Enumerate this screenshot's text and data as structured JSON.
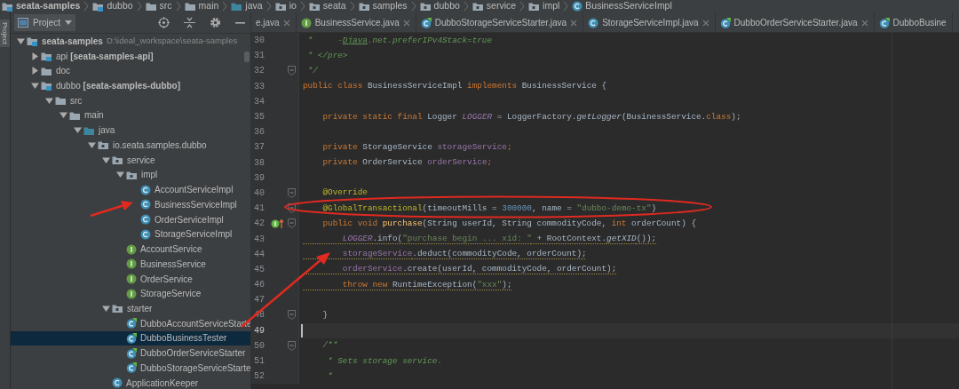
{
  "breadcrumbs": [
    {
      "label": "seata-samples",
      "kind": "module"
    },
    {
      "label": "dubbo",
      "kind": "module"
    },
    {
      "label": "src",
      "kind": "folder"
    },
    {
      "label": "main",
      "kind": "folder"
    },
    {
      "label": "java",
      "kind": "source"
    },
    {
      "label": "io",
      "kind": "package"
    },
    {
      "label": "seata",
      "kind": "package"
    },
    {
      "label": "samples",
      "kind": "package"
    },
    {
      "label": "dubbo",
      "kind": "package"
    },
    {
      "label": "service",
      "kind": "package"
    },
    {
      "label": "impl",
      "kind": "package"
    },
    {
      "label": "BusinessServiceImpl",
      "kind": "class"
    }
  ],
  "side_strip": {
    "label": "Project"
  },
  "project_panel": {
    "title": "Project",
    "tree": [
      {
        "label": "seata-samples",
        "path": "D:\\ideal_workspace\\seata-samples",
        "kind": "module",
        "expanded": true,
        "selected": false,
        "children": [
          {
            "label": "api **[seata-samples-api]**",
            "kind": "module",
            "expanded": false,
            "selected": false
          },
          {
            "label": "doc",
            "kind": "folder",
            "expanded": false,
            "selected": false
          },
          {
            "label": "dubbo **[seata-samples-dubbo]**",
            "kind": "module",
            "expanded": true,
            "selected": false,
            "children": [
              {
                "label": "src",
                "kind": "folder",
                "expanded": true,
                "selected": false,
                "children": [
                  {
                    "label": "main",
                    "kind": "folder",
                    "expanded": true,
                    "selected": false,
                    "children": [
                      {
                        "label": "java",
                        "kind": "source",
                        "expanded": true,
                        "selected": false,
                        "children": [
                          {
                            "label": "io.seata.samples.dubbo",
                            "kind": "package",
                            "expanded": true,
                            "selected": false,
                            "children": [
                              {
                                "label": "service",
                                "kind": "package",
                                "expanded": true,
                                "selected": false,
                                "children": [
                                  {
                                    "label": "impl",
                                    "kind": "package",
                                    "expanded": true,
                                    "selected": false,
                                    "children": [
                                      {
                                        "label": "AccountServiceImpl",
                                        "kind": "class",
                                        "selected": false
                                      },
                                      {
                                        "label": "BusinessServiceImpl",
                                        "kind": "class",
                                        "selected": false
                                      },
                                      {
                                        "label": "OrderServiceImpl",
                                        "kind": "class",
                                        "selected": false
                                      },
                                      {
                                        "label": "StorageServiceImpl",
                                        "kind": "class",
                                        "selected": false
                                      }
                                    ]
                                  },
                                  {
                                    "label": "AccountService",
                                    "kind": "interface",
                                    "selected": false
                                  },
                                  {
                                    "label": "BusinessService",
                                    "kind": "interface",
                                    "selected": false
                                  },
                                  {
                                    "label": "OrderService",
                                    "kind": "interface",
                                    "selected": false
                                  },
                                  {
                                    "label": "StorageService",
                                    "kind": "interface",
                                    "selected": false
                                  }
                                ]
                              },
                              {
                                "label": "starter",
                                "kind": "package",
                                "expanded": true,
                                "selected": false,
                                "children": [
                                  {
                                    "label": "DubboAccountServiceStarte",
                                    "kind": "runnable",
                                    "selected": false
                                  },
                                  {
                                    "label": "DubboBusinessTester",
                                    "kind": "runnable",
                                    "selected": true
                                  },
                                  {
                                    "label": "DubboOrderServiceStarter",
                                    "kind": "runnable",
                                    "selected": false
                                  },
                                  {
                                    "label": "DubboStorageServiceStarte",
                                    "kind": "runnable",
                                    "selected": false
                                  }
                                ]
                              },
                              {
                                "label": "ApplicationKeeper",
                                "kind": "class",
                                "selected": false
                              }
                            ]
                          }
                        ]
                      }
                    ]
                  }
                ]
              }
            ]
          }
        ]
      }
    ]
  },
  "editor": {
    "tabs": [
      {
        "label": "e.java",
        "kind": "none",
        "selected": false
      },
      {
        "label": "BusinessService.java",
        "kind": "interface",
        "selected": false
      },
      {
        "label": "DubboStorageServiceStarter.java",
        "kind": "runnable",
        "selected": false
      },
      {
        "label": "StorageServiceImpl.java",
        "kind": "class",
        "selected": false
      },
      {
        "label": "DubboOrderServiceStarter.java",
        "kind": "runnable",
        "selected": false
      },
      {
        "label": "DubboBusine",
        "kind": "runnable",
        "selected": false
      }
    ],
    "lines": [
      {
        "number": "30",
        "current": false,
        "warning": false,
        "fold": false,
        "overrides": false,
        "tokens": [
          {
            "text": " *     -",
            "kind": "doc"
          },
          {
            "text": "Djava",
            "kind": "doclink"
          },
          {
            "text": ".net.preferIPv4Stack=true",
            "kind": "doc"
          }
        ]
      },
      {
        "number": "31",
        "current": false,
        "warning": false,
        "fold": false,
        "overrides": false,
        "tokens": [
          {
            "text": " * </pre>",
            "kind": "doc"
          }
        ]
      },
      {
        "number": "32",
        "current": false,
        "warning": false,
        "fold": true,
        "overrides": false,
        "tokens": [
          {
            "text": " */",
            "kind": "doc"
          }
        ]
      },
      {
        "number": "33",
        "current": false,
        "warning": false,
        "fold": false,
        "overrides": false,
        "tokens": [
          {
            "text": "public class ",
            "kind": "keyword"
          },
          {
            "text": "BusinessServiceImpl",
            "kind": "plain"
          },
          {
            "text": " implements ",
            "kind": "keyword"
          },
          {
            "text": "BusinessService {",
            "kind": "plain"
          }
        ]
      },
      {
        "number": "34",
        "current": false,
        "fold": false,
        "overrides": false
      },
      {
        "number": "35",
        "current": false,
        "warning": false,
        "fold": false,
        "overrides": false,
        "tokens": [
          {
            "text": "    private static final ",
            "kind": "keyword"
          },
          {
            "text": "Logger ",
            "kind": "plain"
          },
          {
            "text": "LOGGER",
            "kind": "static"
          },
          {
            "text": " = LoggerFactory.",
            "kind": "plain"
          },
          {
            "text": "getLogger",
            "kind": "italic"
          },
          {
            "text": "(BusinessService.",
            "kind": "plain"
          },
          {
            "text": "class",
            "kind": "keyword"
          },
          {
            "text": ");",
            "kind": "plain"
          }
        ]
      },
      {
        "number": "36",
        "current": false,
        "fold": false,
        "overrides": false
      },
      {
        "number": "37",
        "current": false,
        "warning": false,
        "fold": false,
        "overrides": false,
        "tokens": [
          {
            "text": "    private ",
            "kind": "keyword"
          },
          {
            "text": "StorageService ",
            "kind": "plain"
          },
          {
            "text": "storageService",
            "kind": "field"
          },
          {
            "text": ";",
            "kind": "keyword"
          }
        ]
      },
      {
        "number": "38",
        "current": false,
        "warning": false,
        "fold": false,
        "overrides": false,
        "tokens": [
          {
            "text": "    private ",
            "kind": "keyword"
          },
          {
            "text": "OrderService ",
            "kind": "plain"
          },
          {
            "text": "orderService",
            "kind": "field"
          },
          {
            "text": ";",
            "kind": "keyword"
          }
        ]
      },
      {
        "number": "39",
        "current": false,
        "fold": false,
        "overrides": false
      },
      {
        "number": "40",
        "current": false,
        "warning": false,
        "fold": true,
        "overrides": false,
        "tokens": [
          {
            "text": "    @Override",
            "kind": "annotation"
          }
        ]
      },
      {
        "number": "41",
        "current": false,
        "warning": false,
        "fold": true,
        "overrides": false,
        "tokens": [
          {
            "text": "    @GlobalTransactional",
            "kind": "annotation"
          },
          {
            "text": "(timeoutMills = ",
            "kind": "plain"
          },
          {
            "text": "300000",
            "kind": "number"
          },
          {
            "text": ", name = ",
            "kind": "plain"
          },
          {
            "text": "\"dubbo-demo-tx\"",
            "kind": "string"
          },
          {
            "text": ")",
            "kind": "plain"
          }
        ]
      },
      {
        "number": "42",
        "current": false,
        "warning": false,
        "fold": true,
        "overrides": true,
        "tokens": [
          {
            "text": "    public void ",
            "kind": "keyword"
          },
          {
            "text": "purchase",
            "kind": "method"
          },
          {
            "text": "(String userId, String commodityCode, ",
            "kind": "plain"
          },
          {
            "text": "int ",
            "kind": "keyword"
          },
          {
            "text": "orderCount) {",
            "kind": "plain"
          }
        ]
      },
      {
        "number": "43",
        "current": false,
        "warning": true,
        "fold": false,
        "overrides": false,
        "tokens": [
          {
            "text": "        LOGGER",
            "kind": "static"
          },
          {
            "text": ".info(",
            "kind": "plain"
          },
          {
            "text": "\"purchase begin ... xid: \"",
            "kind": "string"
          },
          {
            "text": " + RootContext.",
            "kind": "plain"
          },
          {
            "text": "getXID",
            "kind": "italic"
          },
          {
            "text": "());",
            "kind": "plain"
          }
        ]
      },
      {
        "number": "44",
        "current": false,
        "warning": true,
        "fold": false,
        "overrides": false,
        "tokens": [
          {
            "text": "        storageService",
            "kind": "field"
          },
          {
            "text": ".deduct(commodityCode, orderCount);",
            "kind": "plain"
          }
        ]
      },
      {
        "number": "45",
        "current": false,
        "warning": true,
        "fold": false,
        "overrides": false,
        "tokens": [
          {
            "text": "        orderService",
            "kind": "field"
          },
          {
            "text": ".create(userId, commodityCode, orderCount);",
            "kind": "plain"
          }
        ]
      },
      {
        "number": "46",
        "current": false,
        "warning": true,
        "fold": false,
        "overrides": false,
        "tokens": [
          {
            "text": "        throw new ",
            "kind": "keyword"
          },
          {
            "text": "RuntimeException(",
            "kind": "plain"
          },
          {
            "text": "\"xxx\"",
            "kind": "string"
          },
          {
            "text": ");",
            "kind": "plain"
          }
        ]
      },
      {
        "number": "47",
        "current": false,
        "fold": false,
        "overrides": false
      },
      {
        "number": "48",
        "current": false,
        "warning": false,
        "fold": true,
        "overrides": false,
        "tokens": [
          {
            "text": "    }",
            "kind": "plain"
          }
        ]
      },
      {
        "number": "49",
        "current": true,
        "fold": false,
        "overrides": false
      },
      {
        "number": "50",
        "current": false,
        "warning": false,
        "fold": true,
        "overrides": false,
        "tokens": [
          {
            "text": "    /**",
            "kind": "doc"
          }
        ]
      },
      {
        "number": "51",
        "current": false,
        "warning": false,
        "fold": false,
        "overrides": false,
        "tokens": [
          {
            "text": "     * Sets storage service.",
            "kind": "doc"
          }
        ]
      },
      {
        "number": "52",
        "current": false,
        "warning": false,
        "fold": false,
        "overrides": false,
        "tokens": [
          {
            "text": "     *",
            "kind": "doc"
          }
        ]
      }
    ]
  }
}
